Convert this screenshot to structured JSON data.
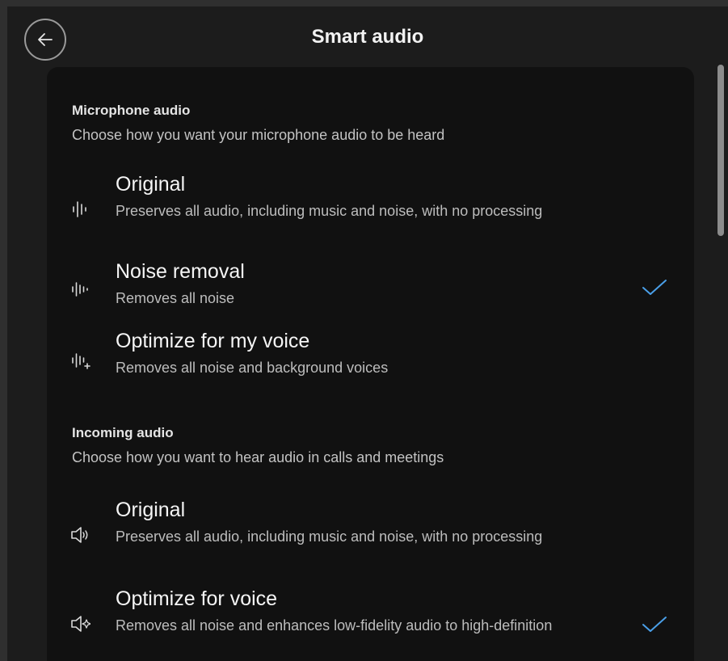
{
  "header": {
    "title": "Smart audio",
    "back_icon": "arrow-left-icon"
  },
  "microphone": {
    "title": "Microphone audio",
    "description": "Choose how you want your microphone audio to be heard",
    "options": [
      {
        "label": "Original",
        "description": "Preserves all audio, including music and noise, with no processing",
        "icon": "waveform-icon",
        "selected": false
      },
      {
        "label": "Noise removal",
        "description": "Removes all noise",
        "icon": "waveform-noise-removal-icon",
        "selected": true
      },
      {
        "label": "Optimize for my voice",
        "description": "Removes all noise and background voices",
        "icon": "waveform-voice-icon",
        "selected": false
      }
    ]
  },
  "incoming": {
    "title": "Incoming audio",
    "description": "Choose how you want to hear audio in calls and meetings",
    "options": [
      {
        "label": "Original",
        "description": "Preserves all audio, including music and noise, with no processing",
        "icon": "speaker-sound-icon",
        "selected": false
      },
      {
        "label": "Optimize for voice",
        "description": "Removes all noise and enhances low-fidelity audio to high-definition",
        "icon": "speaker-sparkle-icon",
        "selected": true
      }
    ]
  },
  "colors": {
    "accent_check": "#4a9fe8",
    "background": "#1c1c1c",
    "card": "#111111"
  }
}
